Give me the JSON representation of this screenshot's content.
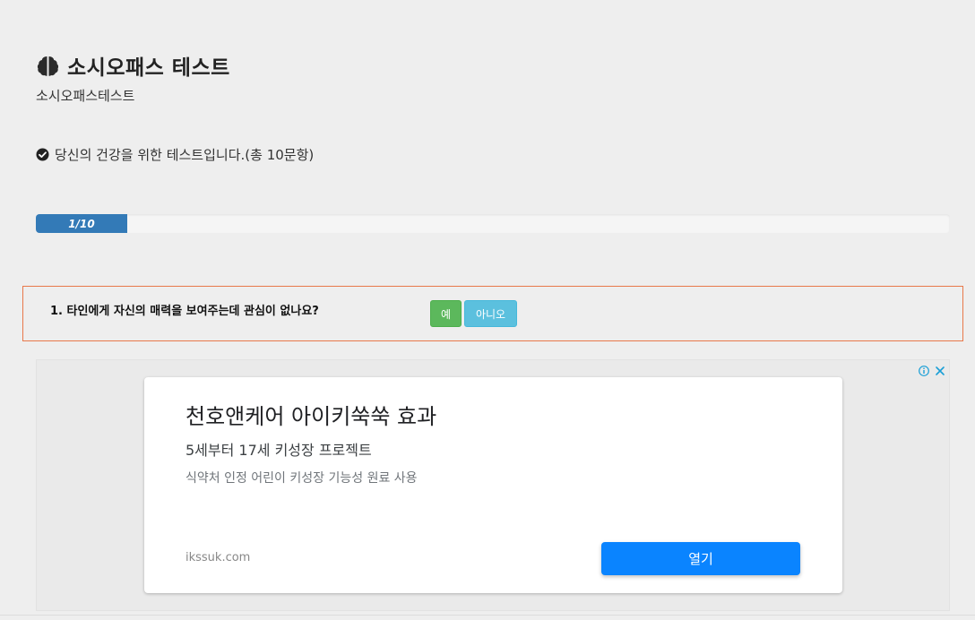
{
  "header": {
    "icon": "brain-icon",
    "title": "소시오패스 테스트",
    "subtitle": "소시오패스테스트"
  },
  "info": {
    "icon": "check-circle-icon",
    "text": "당신의 건강을 위한 테스트입니다.(총 10문항)"
  },
  "progress": {
    "label": "1/10",
    "current": 1,
    "total": 10,
    "fraction": 0.1,
    "color": "#337ab7"
  },
  "question": {
    "text": "1. 타인에게 자신의 매력을 보여주는데 관심이 없나요?",
    "yes_label": "예",
    "no_label": "아니오",
    "border_color": "#e8784a",
    "yes_color": "#5cb85c",
    "no_color": "#5bc0de"
  },
  "ad": {
    "info_icon": "info-icon",
    "close_icon": "close-icon",
    "headline": "천호앤케어 아이키쑥쑥 효과",
    "subhead": "5세부터 17세 키성장 프로젝트",
    "description": "식약처 인정 어린이 키성장 기능성 원료 사용",
    "domain": "ikssuk.com",
    "button_label": "열기",
    "button_color": "#0a84ff"
  }
}
